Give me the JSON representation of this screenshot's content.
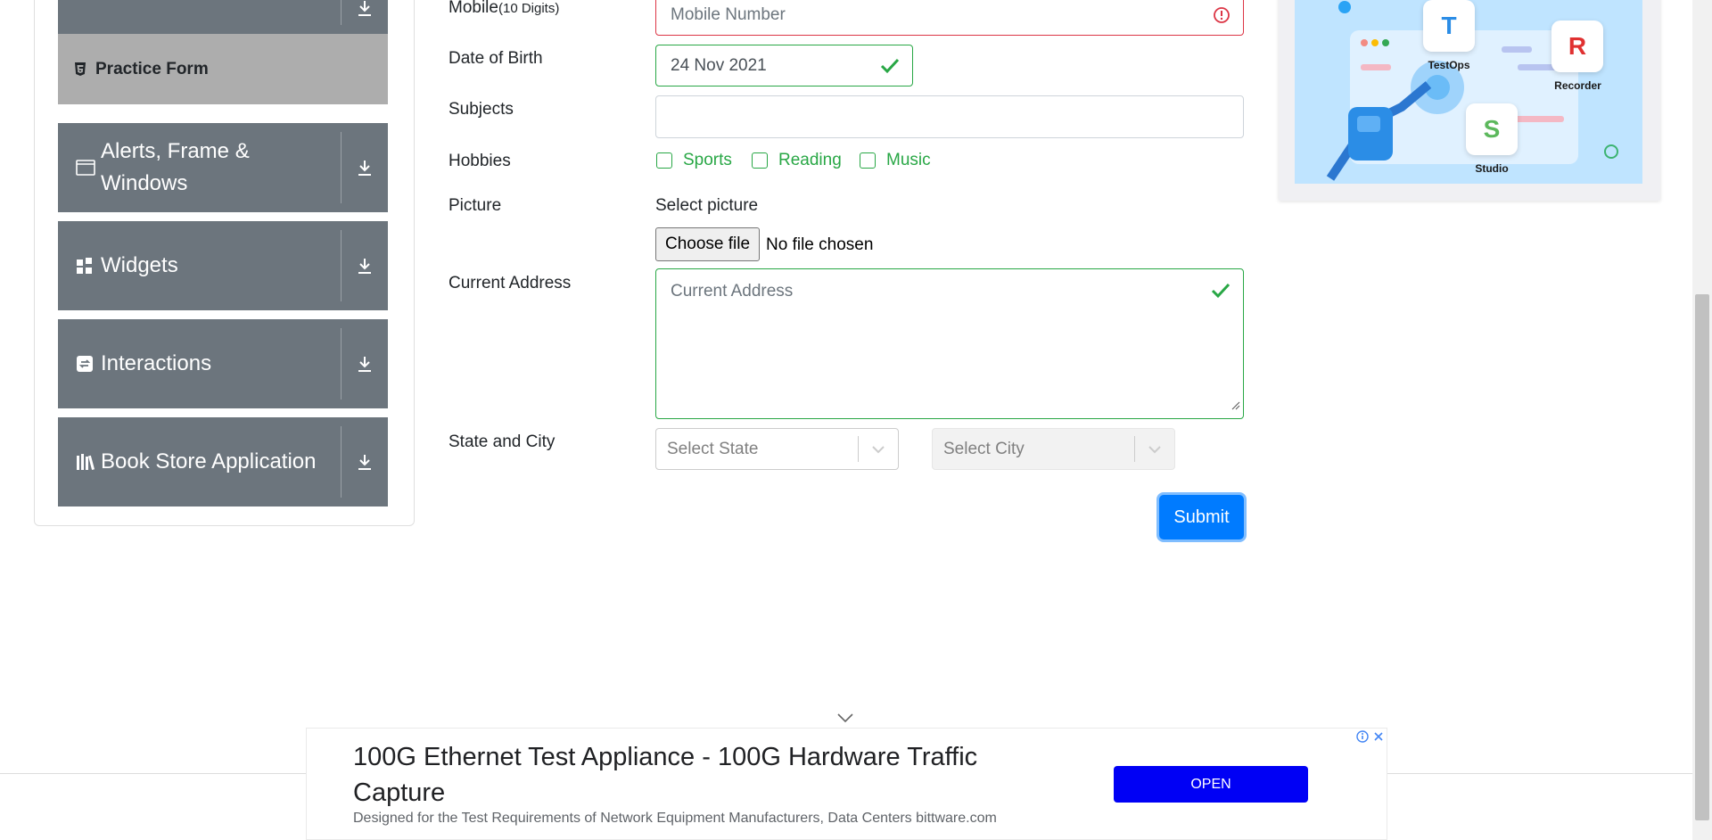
{
  "sidebar": {
    "practice_form": "Practice Form",
    "groups": [
      {
        "label_line1": "Alerts, Frame &",
        "label_line2": "Windows",
        "icon": "window-icon"
      },
      {
        "label": "Widgets",
        "icon": "widgets-icon"
      },
      {
        "label": "Interactions",
        "icon": "interactions-icon"
      },
      {
        "label": "Book Store Application",
        "icon": "books-icon"
      }
    ]
  },
  "form": {
    "mobile": {
      "label": "Mobile",
      "label_hint": "(10 Digits)",
      "placeholder": "Mobile Number"
    },
    "dob": {
      "label": "Date of Birth",
      "value": "24 Nov 2021"
    },
    "subjects": {
      "label": "Subjects",
      "value": ""
    },
    "hobbies": {
      "label": "Hobbies",
      "options": [
        "Sports",
        "Reading",
        "Music"
      ]
    },
    "picture": {
      "label": "Picture",
      "select_label": "Select picture",
      "button": "Choose file",
      "status": "No file chosen"
    },
    "address": {
      "label": "Current Address",
      "placeholder": "Current Address"
    },
    "state_city": {
      "label": "State and City",
      "state_placeholder": "Select State",
      "city_placeholder": "Select City"
    },
    "submit": "Submit"
  },
  "banner": {
    "products": [
      "TestOps",
      "Recorder",
      "Studio"
    ]
  },
  "ad": {
    "title": "100G Ethernet Test Appliance - 100G Hardware Traffic Capture",
    "description": "Designed for the Test Requirements of Network Equipment Manufacturers, Data Centers bittware.com",
    "button": "OPEN"
  },
  "colors": {
    "sidebar_bg": "#6c757d",
    "active_item_bg": "#adadad",
    "valid": "#28a745",
    "invalid": "#dc3545",
    "primary": "#007bff",
    "ad_button": "#0000f5"
  }
}
